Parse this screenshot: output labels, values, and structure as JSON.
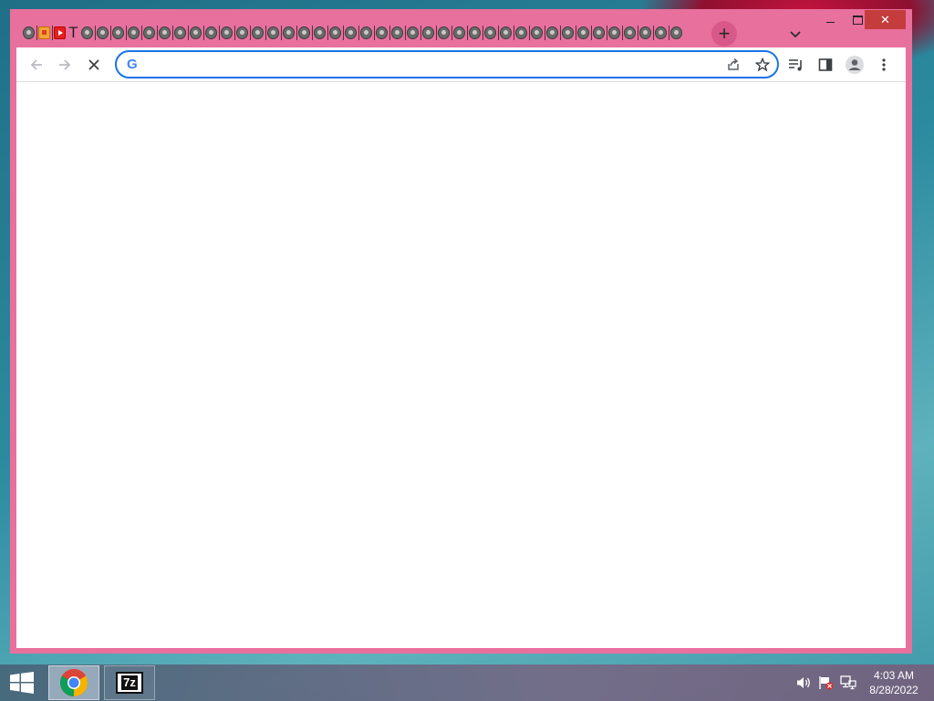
{
  "window": {
    "tab_strip": {
      "icon_count": 47,
      "letter_tab": "T",
      "new_tab_label": "+",
      "tab_search_label": "⌄"
    },
    "controls": {
      "minimize": "–",
      "close": "✕"
    },
    "accent_color": "#e8709d"
  },
  "toolbar": {
    "back_icon": "arrow-left-icon",
    "forward_icon": "arrow-right-icon",
    "stop_icon": "close-icon",
    "omnibox": {
      "value": "",
      "placeholder": "",
      "logo": "G"
    },
    "share_icon": "share-icon",
    "bookmark_icon": "star-icon",
    "media_icon": "media-controls-icon",
    "side_panel_icon": "side-panel-icon",
    "profile_icon": "profile-icon",
    "menu_icon": "kebab-menu-icon"
  },
  "taskbar": {
    "apps": [
      {
        "name": "Google Chrome",
        "icon": "chrome-icon",
        "active": true
      },
      {
        "name": "7-Zip",
        "icon": "7zip-icon",
        "label": "7z",
        "active": false
      }
    ],
    "tray": [
      "volume-icon",
      "network-flag-icon",
      "network-icon"
    ],
    "clock": {
      "time": "4:03 AM",
      "date": "8/28/2022"
    }
  }
}
